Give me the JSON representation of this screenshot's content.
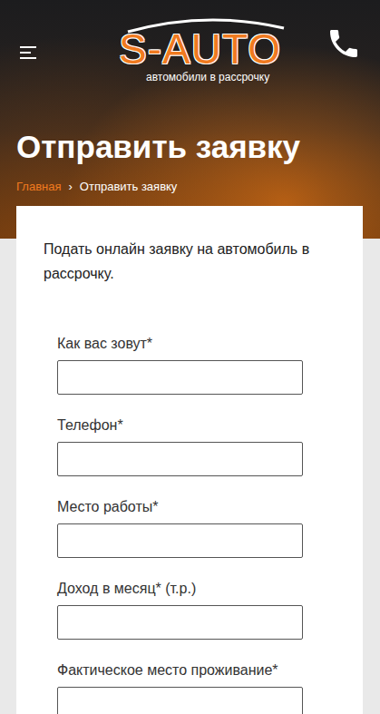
{
  "header": {
    "logo": {
      "title": "S-AUTO",
      "subtitle": "автомобили в рассрочку"
    },
    "title": "Отправить заявку",
    "breadcrumbs": [
      {
        "label": "Главная",
        "selected": false
      },
      {
        "label": "Отправить заявку",
        "selected": true
      }
    ],
    "separator": "›"
  },
  "form": {
    "intro": "Подать онлайн заявку на автомобиль в рассрочку.",
    "fields": [
      {
        "label": "Как вас зовут*",
        "value": ""
      },
      {
        "label": "Телефон*",
        "value": ""
      },
      {
        "label": "Место работы*",
        "value": ""
      },
      {
        "label": "Доход в месяц* (т.р.)",
        "value": ""
      },
      {
        "label": "Фактическое место проживание*",
        "value": ""
      }
    ]
  }
}
